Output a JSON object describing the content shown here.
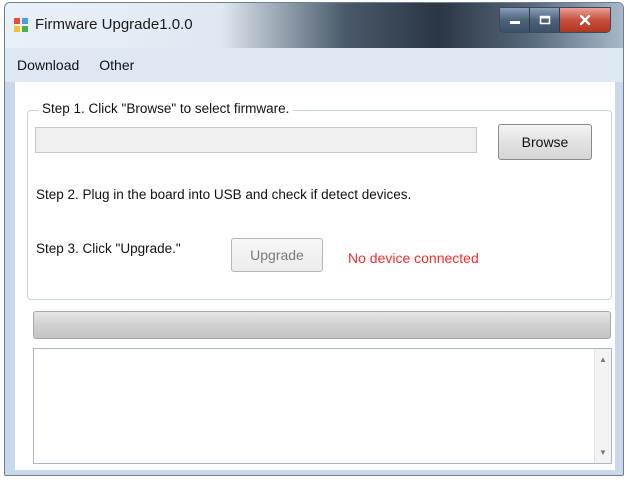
{
  "window": {
    "title": "Firmware Upgrade1.0.0",
    "icon": "app-icon"
  },
  "menu": {
    "items": [
      "Download",
      "Other"
    ]
  },
  "step1": {
    "label": "Step 1. Click \"Browse\" to select firmware.",
    "path_value": "",
    "browse_label": "Browse"
  },
  "step2": {
    "label": "Step 2. Plug in the board into USB and check if detect devices."
  },
  "step3": {
    "label": "Step 3. Click \"Upgrade.\"",
    "upgrade_label": "Upgrade",
    "status": "No device connected",
    "status_color": "#ff2a2a"
  },
  "progress": {
    "percent": 0
  },
  "log": {
    "text": ""
  }
}
